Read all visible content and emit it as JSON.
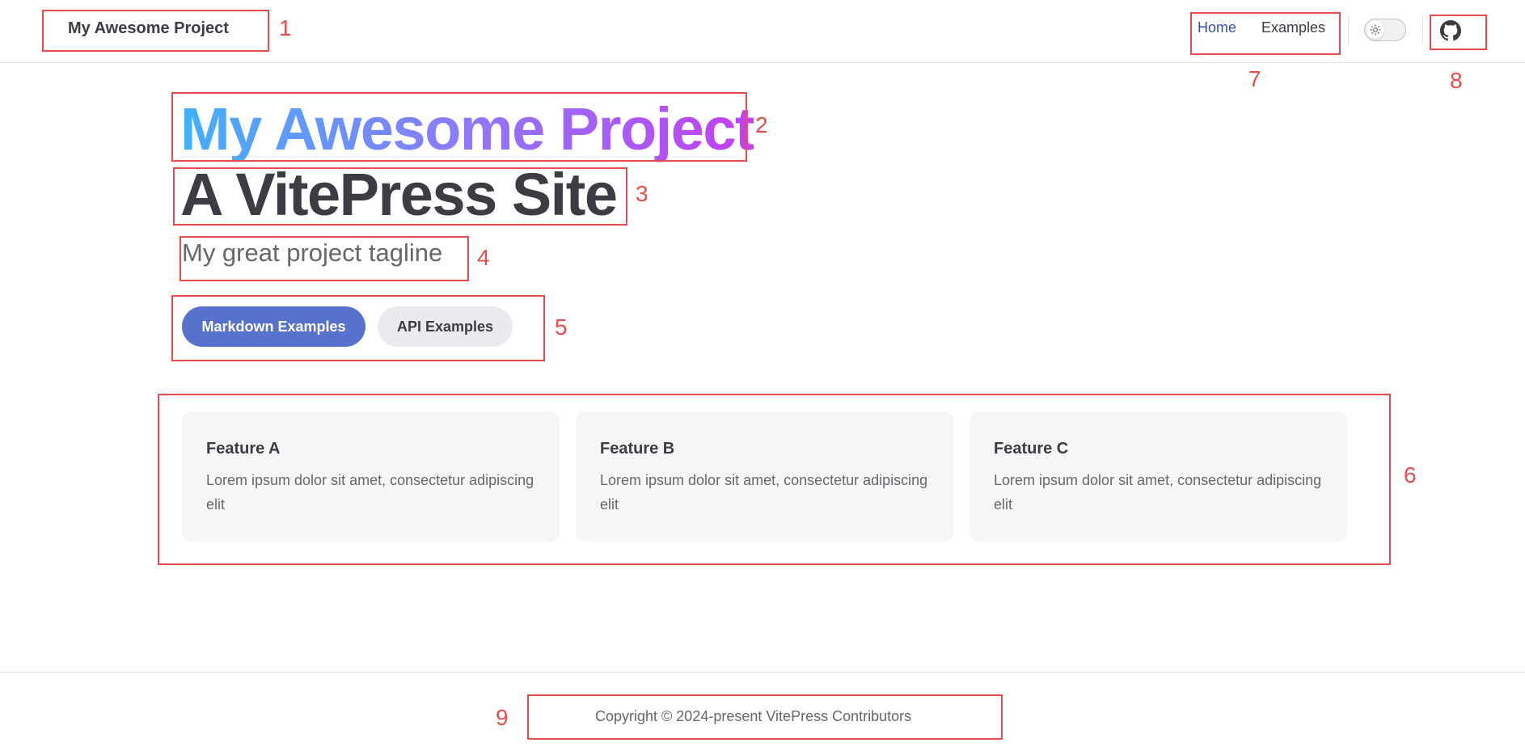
{
  "navbar": {
    "site_title": "My Awesome Project",
    "links": [
      {
        "label": "Home",
        "active": true
      },
      {
        "label": "Examples",
        "active": false
      }
    ],
    "appearance_icon": "sun-icon",
    "social_icon": "github-icon"
  },
  "hero": {
    "name": "My Awesome Project",
    "text": "A VitePress Site",
    "tagline": "My great project tagline",
    "actions": [
      {
        "label": "Markdown Examples",
        "theme": "brand"
      },
      {
        "label": "API Examples",
        "theme": "alt"
      }
    ]
  },
  "features": [
    {
      "title": "Feature A",
      "details": "Lorem ipsum dolor sit amet, consectetur adipiscing elit"
    },
    {
      "title": "Feature B",
      "details": "Lorem ipsum dolor sit amet, consectetur adipiscing elit"
    },
    {
      "title": "Feature C",
      "details": "Lorem ipsum dolor sit amet, consectetur adipiscing elit"
    }
  ],
  "footer": {
    "copyright": "Copyright © 2024-present VitePress Contributors"
  },
  "annotations": [
    "1",
    "2",
    "3",
    "4",
    "5",
    "6",
    "7",
    "8",
    "9"
  ],
  "colors": {
    "brand": "#5672cd",
    "active_link": "#3451b2",
    "annotation": "#e84c4c",
    "name_gradient_start": "#41b0ff",
    "name_gradient_end": "#c33ff2"
  }
}
